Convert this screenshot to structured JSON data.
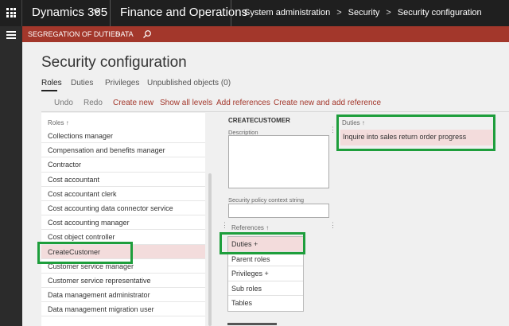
{
  "topbar": {
    "app_name": "Dynamics 365",
    "module": "Finance and Operations",
    "breadcrumb": [
      "System administration",
      "Security",
      "Security configuration"
    ]
  },
  "actionbar": {
    "items": [
      "SEGREGATION OF DUTIES",
      "DATA"
    ]
  },
  "page": {
    "title": "Security configuration",
    "tabs": [
      "Roles",
      "Duties",
      "Privileges",
      "Unpublished objects (0)"
    ],
    "active_tab": "Roles"
  },
  "toolbar": {
    "undo": "Undo",
    "redo": "Redo",
    "create_new": "Create new",
    "show_all_levels": "Show all levels",
    "add_references": "Add references",
    "create_new_and_add_reference": "Create new and add reference"
  },
  "roles": {
    "header": "Roles",
    "sort_indicator": "↑",
    "items": [
      "Collections manager",
      "Compensation and benefits manager",
      "Contractor",
      "Cost accountant",
      "Cost accountant clerk",
      "Cost accounting data connector service",
      "Cost accounting manager",
      "Cost object controller",
      "CreateCustomer",
      "Customer service manager",
      "Customer service representative",
      "Data management administrator",
      "Data management migration user"
    ],
    "selected": "CreateCustomer"
  },
  "detail": {
    "role_name": "CREATECUSTOMER",
    "description_label": "Description",
    "description_value": "",
    "context_label": "Security policy context string",
    "context_value": "",
    "references_header": "References",
    "references_sort": "↑",
    "references": [
      "Duties +",
      "Parent roles",
      "Privileges +",
      "Sub roles",
      "Tables"
    ],
    "selected_reference": "Duties +"
  },
  "duties": {
    "header": "Duties",
    "sort_indicator": "↑",
    "items": [
      "Inquire into sales return order progress"
    ]
  },
  "colors": {
    "topbar_bg": "#1f1f1f",
    "accent_red": "#a3372b",
    "selection_bg": "#f3dcdc",
    "highlight_green": "#1e9e3c"
  }
}
